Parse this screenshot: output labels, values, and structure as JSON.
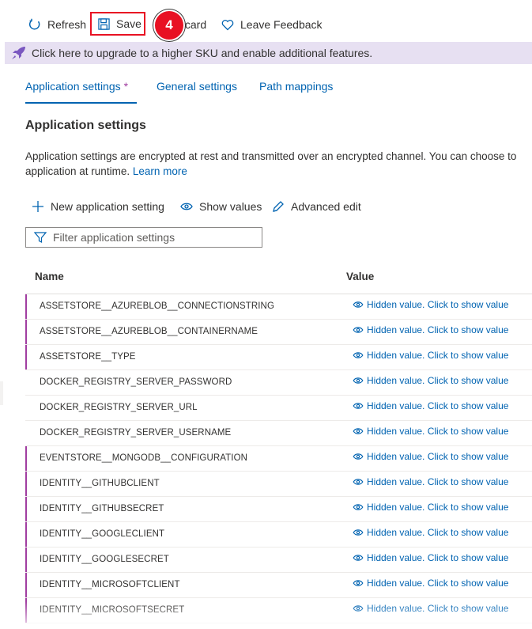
{
  "toolbar": {
    "refresh_label": "Refresh",
    "save_label": "Save",
    "discard_label": ".card",
    "feedback_label": "Leave Feedback",
    "step_badge": "4"
  },
  "banner": {
    "text": "Click here to upgrade to a higher SKU and enable additional features."
  },
  "tabs": [
    {
      "label": "Application settings",
      "modified_marker": "*"
    },
    {
      "label": "General settings"
    },
    {
      "label": "Path mappings"
    }
  ],
  "section": {
    "title": "Application settings",
    "description_line1": "Application settings are encrypted at rest and transmitted over an encrypted channel. You can choose to",
    "description_line2": "application at runtime.",
    "learn_more": "Learn more"
  },
  "commands": {
    "new_label": "New application setting",
    "show_values_label": "Show values",
    "advanced_edit_label": "Advanced edit"
  },
  "filter": {
    "placeholder": "Filter application settings"
  },
  "table": {
    "columns": [
      "Name",
      "Value"
    ],
    "hidden_value_text": "Hidden value. Click to show value",
    "rows": [
      {
        "name": "ASSETSTORE__AZUREBLOB__CONNECTIONSTRING",
        "marked": true
      },
      {
        "name": "ASSETSTORE__AZUREBLOB__CONTAINERNAME",
        "marked": true
      },
      {
        "name": "ASSETSTORE__TYPE",
        "marked": true
      },
      {
        "name": "DOCKER_REGISTRY_SERVER_PASSWORD",
        "marked": false
      },
      {
        "name": "DOCKER_REGISTRY_SERVER_URL",
        "marked": false
      },
      {
        "name": "DOCKER_REGISTRY_SERVER_USERNAME",
        "marked": false
      },
      {
        "name": "EVENTSTORE__MONGODB__CONFIGURATION",
        "marked": true
      },
      {
        "name": "IDENTITY__GITHUBCLIENT",
        "marked": true
      },
      {
        "name": "IDENTITY__GITHUBSECRET",
        "marked": true
      },
      {
        "name": "IDENTITY__GOOGLECLIENT",
        "marked": true
      },
      {
        "name": "IDENTITY__GOOGLESECRET",
        "marked": true
      },
      {
        "name": "IDENTITY__MICROSOFTCLIENT",
        "marked": true
      },
      {
        "name": "IDENTITY__MICROSOFTSECRET",
        "marked": true
      }
    ]
  },
  "colors": {
    "accent": "#0063b1",
    "modified": "#a13ea1",
    "highlight": "#e81123",
    "banner_bg": "#e7e0f2"
  },
  "icons": [
    "refresh-icon",
    "save-icon",
    "heart-icon",
    "rocket-icon",
    "plus-icon",
    "eye-icon",
    "pencil-icon",
    "filter-icon"
  ]
}
